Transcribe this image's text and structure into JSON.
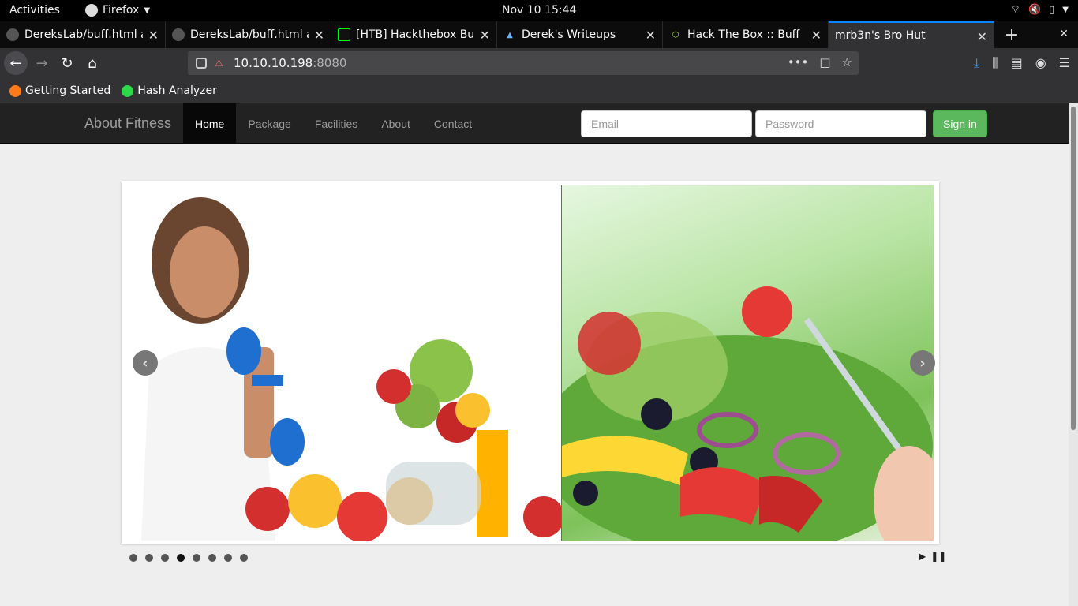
{
  "system": {
    "activities": "Activities",
    "app_name": "Firefox",
    "clock": "Nov 10  15:44"
  },
  "tabs": [
    {
      "title": "DereksLab/buff.html at",
      "active": false
    },
    {
      "title": "DereksLab/buff.html at",
      "active": false
    },
    {
      "title": "[HTB] Hackthebox Buff",
      "active": false
    },
    {
      "title": "Derek's Writeups",
      "active": false
    },
    {
      "title": "Hack The Box :: Buff",
      "active": false
    },
    {
      "title": "mrb3n's Bro Hut",
      "active": true
    }
  ],
  "urlbar": {
    "host": "10.10.10.198",
    "port": ":8080"
  },
  "bookmarks": [
    {
      "label": "Getting Started"
    },
    {
      "label": "Hash Analyzer"
    }
  ],
  "site": {
    "brand": "About Fitness",
    "nav": [
      {
        "label": "Home",
        "active": true
      },
      {
        "label": "Package"
      },
      {
        "label": "Facilities"
      },
      {
        "label": "About"
      },
      {
        "label": "Contact"
      }
    ],
    "email_placeholder": "Email",
    "password_placeholder": "Password",
    "signin_label": "Sign in"
  },
  "slider": {
    "slide_count": 8,
    "active_slide_index": 3
  },
  "colors": {
    "signin_green": "#5cb85c",
    "nav_dark": "#222222",
    "tab_active_accent": "#0a84ff"
  }
}
